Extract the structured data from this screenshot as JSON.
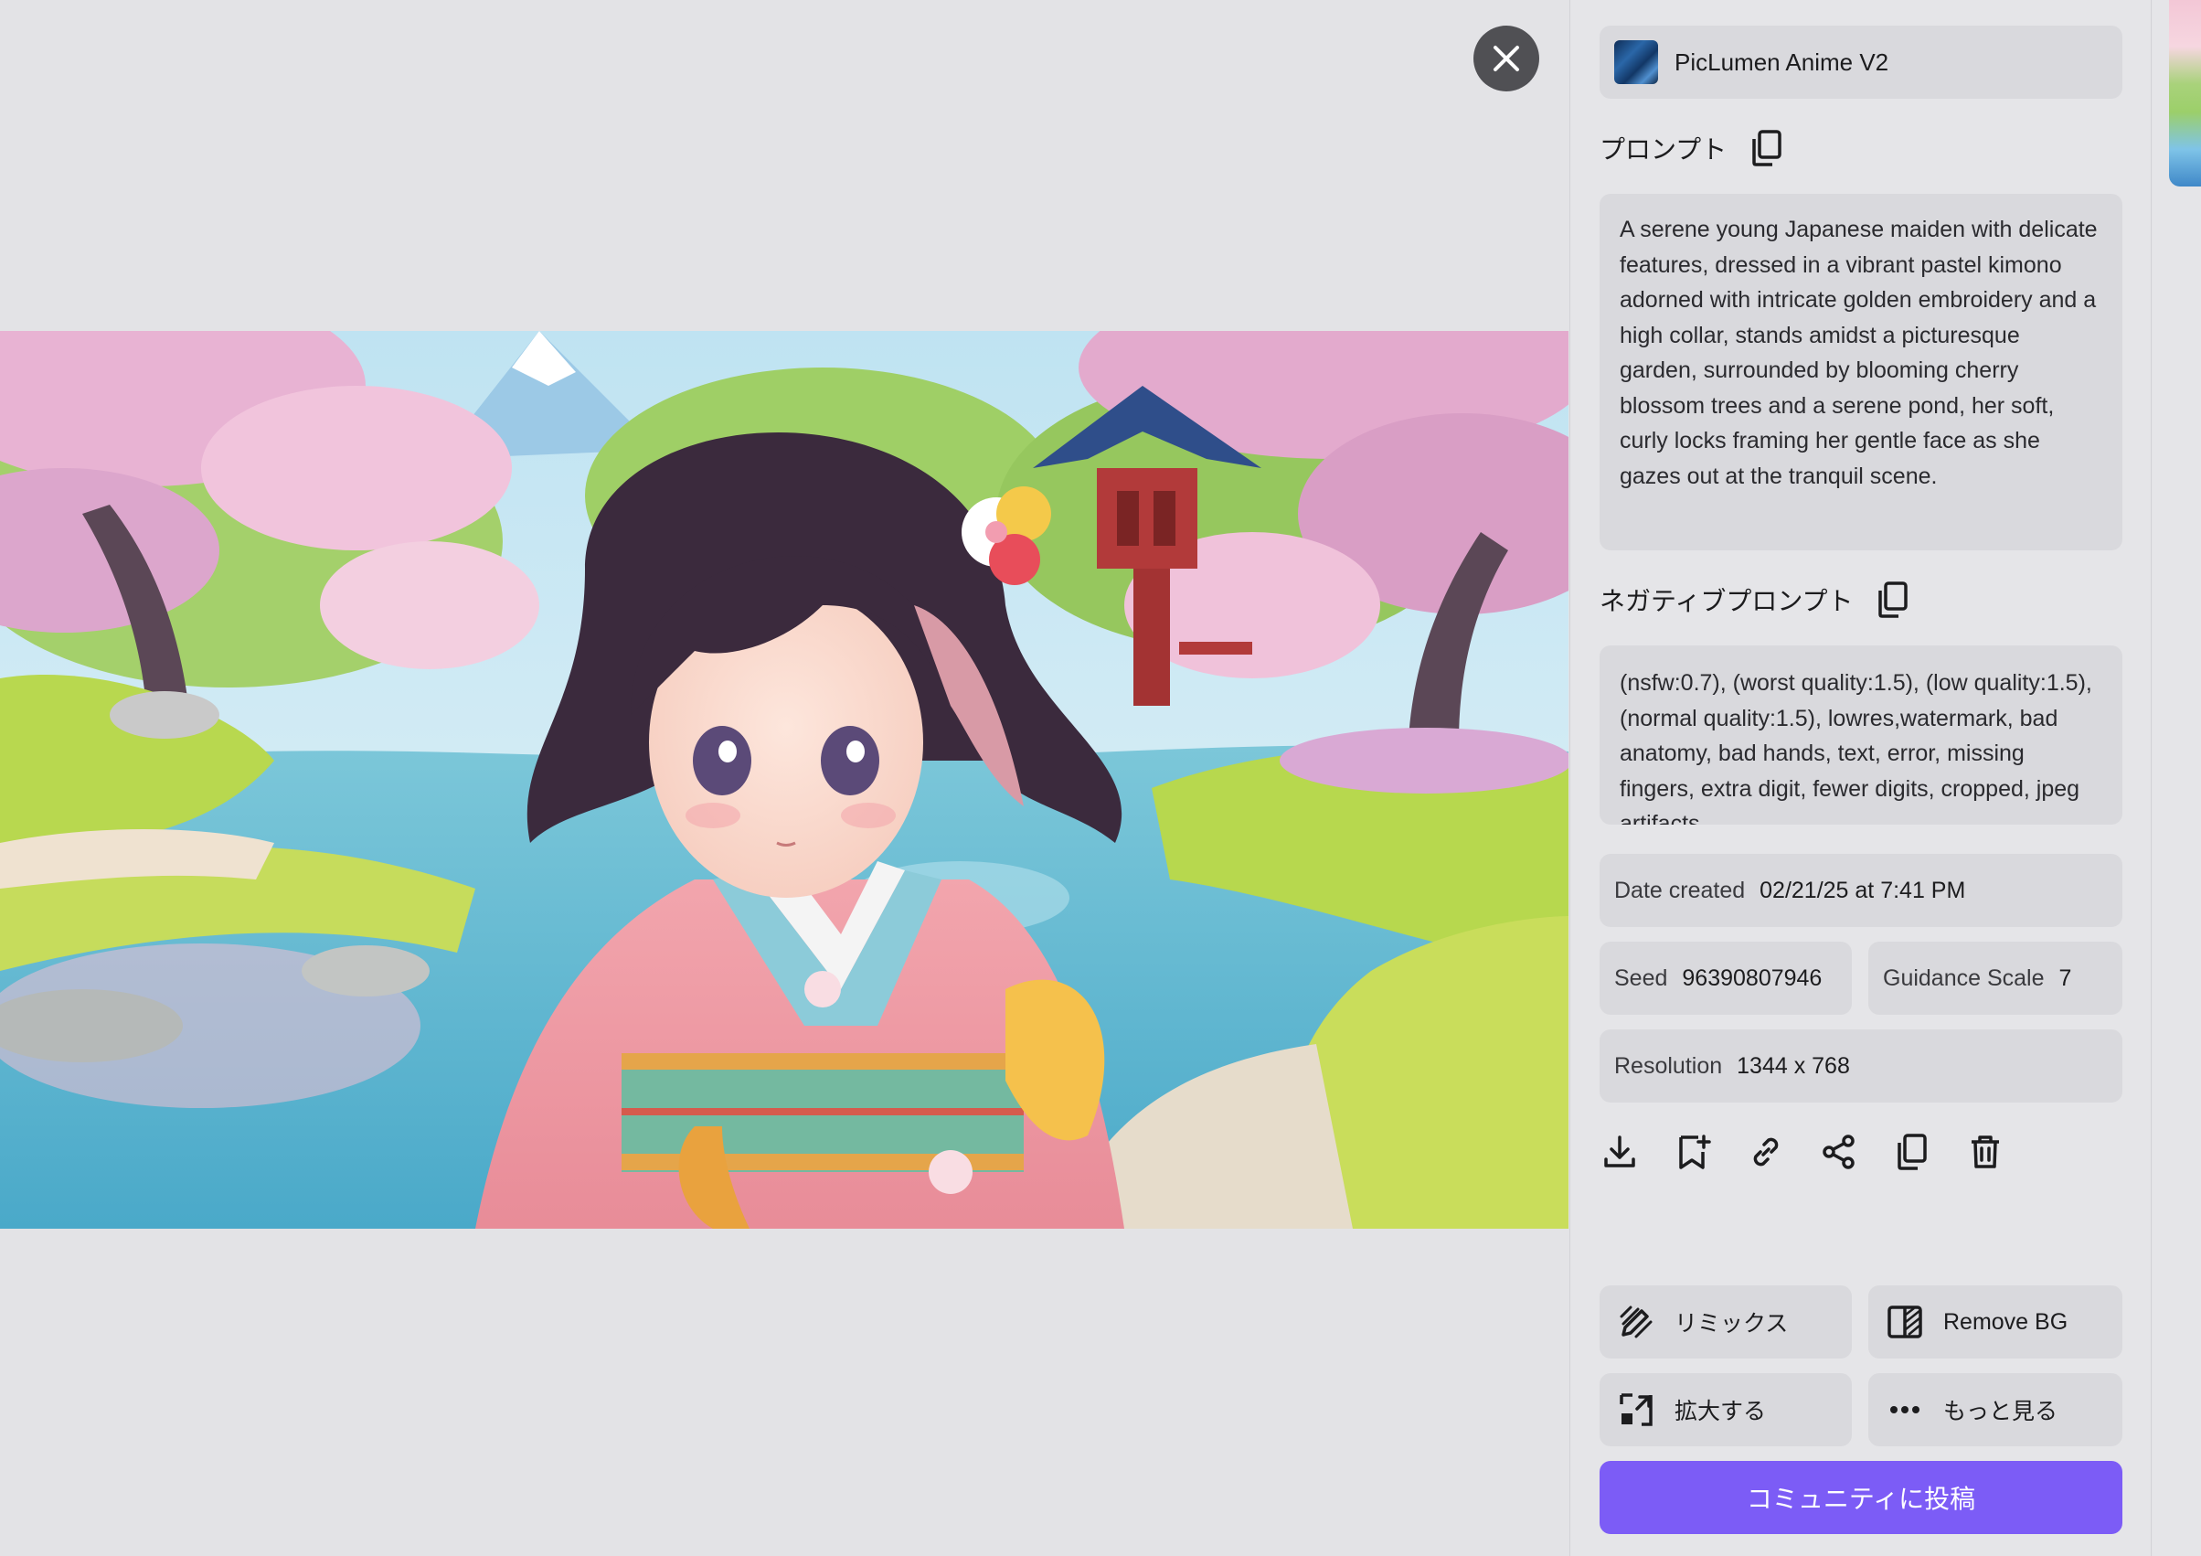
{
  "viewer": {
    "close_icon": "close-icon"
  },
  "panel": {
    "model": {
      "name": "PicLumen Anime V2"
    },
    "prompt": {
      "title": "プロンプト",
      "text": "A serene young Japanese maiden with delicate features, dressed in a vibrant pastel kimono adorned with intricate golden embroidery and a high collar, stands amidst a picturesque garden, surrounded by blooming cherry blossom trees and a serene pond, her soft, curly locks framing her gentle face as she gazes out at the tranquil scene."
    },
    "negative_prompt": {
      "title": "ネガティブプロンプト",
      "text": "(nsfw:0.7), (worst quality:1.5), (low quality:1.5), (normal quality:1.5), lowres,watermark, bad anatomy, bad hands, text, error, missing fingers, extra digit, fewer digits, cropped, jpeg artifacts"
    },
    "info": {
      "date_label": "Date created",
      "date_value": "02/21/25 at 7:41 PM",
      "seed_label": "Seed",
      "seed_value": "96390807946",
      "guidance_label": "Guidance Scale",
      "guidance_value": "7",
      "resolution_label": "Resolution",
      "resolution_value": "1344 x 768"
    },
    "actions": [
      "download-icon",
      "bookmark-add-icon",
      "link-icon",
      "share-icon",
      "copy-icon",
      "trash-icon"
    ],
    "tools": {
      "remix": "リミックス",
      "remove_bg": "Remove BG",
      "upscale": "拡大する",
      "more": "もっと見る"
    },
    "post_button": "コミュニティに投稿",
    "colors": {
      "accent": "#7c5cf6",
      "panel_bg": "#e5e5e8",
      "card_bg": "#d9d9dd"
    }
  }
}
